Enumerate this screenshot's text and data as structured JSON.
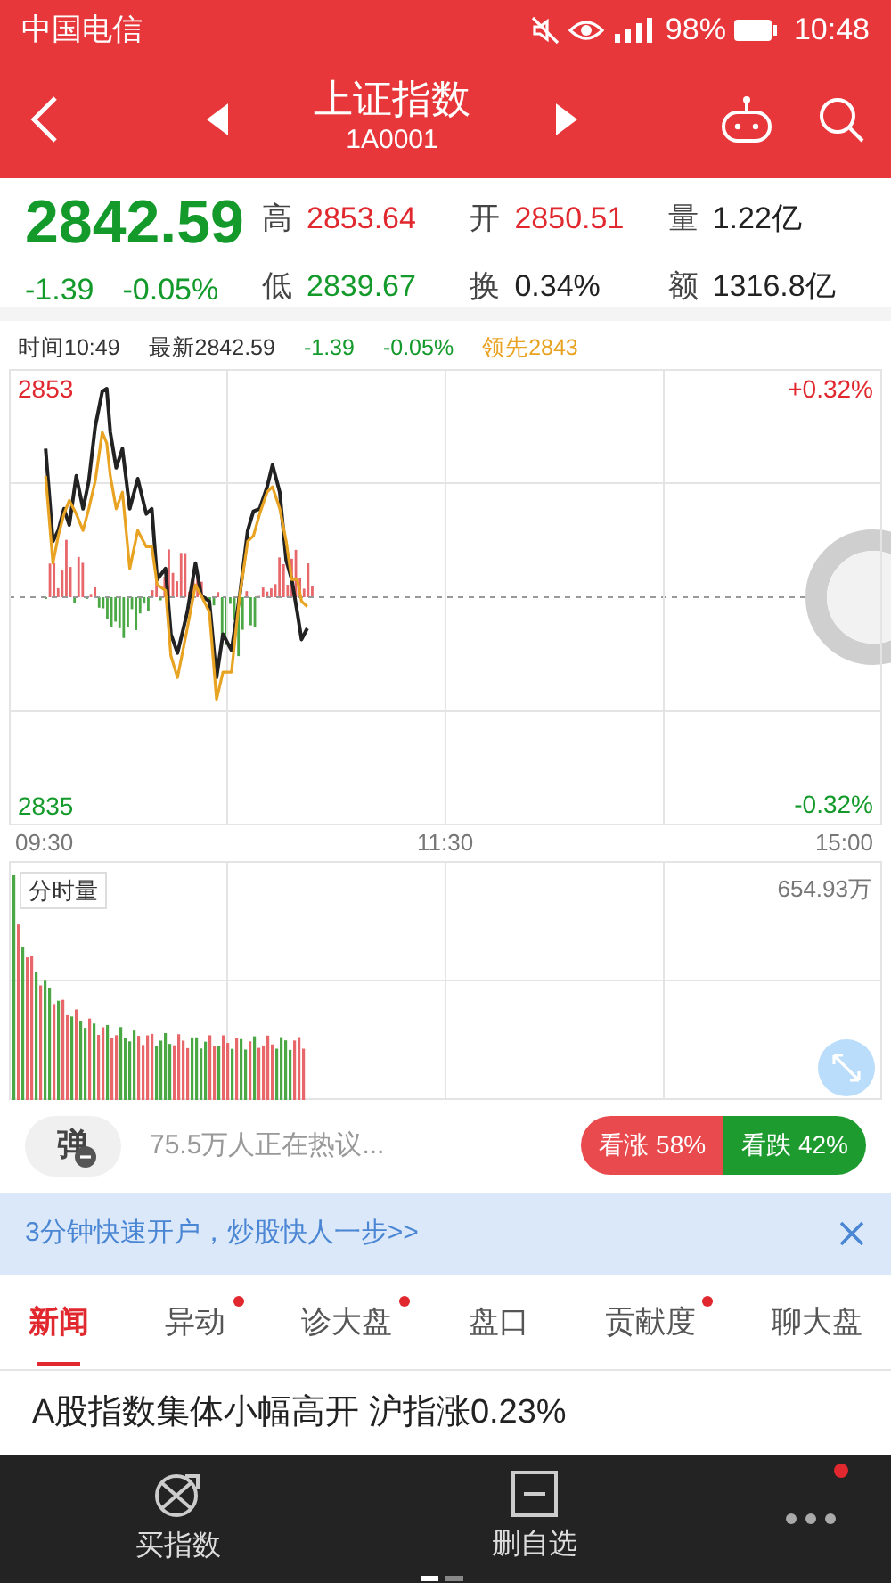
{
  "status_bar": {
    "carrier": "中国电信",
    "battery": "98%",
    "time": "10:48"
  },
  "header": {
    "title": "上证指数",
    "code": "1A0001"
  },
  "quote": {
    "price": "2842.59",
    "change": "-1.39",
    "change_pct": "-0.05%",
    "color": "#139a2b",
    "stats": [
      {
        "label": "高",
        "value": "2853.64",
        "color": "#e0282e"
      },
      {
        "label": "开",
        "value": "2850.51",
        "color": "#e0282e"
      },
      {
        "label": "量",
        "value": "1.22亿",
        "color": "#222222"
      },
      {
        "label": "低",
        "value": "2839.67",
        "color": "#139a2b"
      },
      {
        "label": "换",
        "value": "0.34%",
        "color": "#222222"
      },
      {
        "label": "额",
        "value": "1316.8亿",
        "color": "#222222"
      }
    ]
  },
  "legend": [
    {
      "text": "时间10:49",
      "color": "#333333"
    },
    {
      "text": "最新2842.59",
      "color": "#333333"
    },
    {
      "text": "-1.39",
      "color": "#139a2b"
    },
    {
      "text": "-0.05%",
      "color": "#139a2b"
    },
    {
      "text": "领先2843",
      "color": "#e8a322"
    }
  ],
  "chart": {
    "right_labels": [
      "+0.32%",
      "-0.32%"
    ],
    "close_label": "15:00",
    "chart_data": {
      "type": "line",
      "xlim": [
        9.322,
        13.678
      ],
      "ylim": [
        2834.15,
        2853.85
      ],
      "xticks": [
        {
          "value": 9.5,
          "label": "09:30"
        },
        {
          "value": 11.5,
          "label": "11:30"
        }
      ],
      "yticks": [
        {
          "value": 2853,
          "label": "2853"
        },
        {
          "value": 2835,
          "label": "2835"
        }
      ],
      "x": [
        9.505,
        9.542,
        9.568,
        9.597,
        9.623,
        9.658,
        9.692,
        9.72,
        9.752,
        9.788,
        9.81,
        9.828,
        9.857,
        9.888,
        9.925,
        9.965,
        10.007,
        10.035,
        10.062,
        10.103,
        10.13,
        10.163,
        10.212,
        10.253,
        10.282,
        10.322,
        10.358,
        10.39,
        10.432,
        10.473,
        10.513,
        10.542,
        10.573,
        10.61,
        10.637,
        10.673,
        10.705,
        10.733,
        10.76,
        10.782,
        10.81
      ],
      "series": [
        {
          "color": "#222222",
          "values": [
            2850.41,
            2846.41,
            2846.88,
            2847.82,
            2847.12,
            2849.24,
            2847.82,
            2849.0,
            2851.35,
            2852.88,
            2853.0,
            2851.12,
            2849.59,
            2850.41,
            2847.82,
            2849.12,
            2847.59,
            2847.82,
            2844.76,
            2845.24,
            2842.41,
            2841.59,
            2843.35,
            2845.47,
            2844.06,
            2843.82,
            2840.53,
            2842.41,
            2841.71,
            2844.06,
            2846.88,
            2847.71,
            2847.82,
            2848.76,
            2849.71,
            2848.53,
            2845.59,
            2844.76,
            2843.35,
            2842.18,
            2842.65
          ]
        },
        {
          "color": "#e8a322",
          "values": [
            2849.24,
            2845.47,
            2846.65,
            2847.59,
            2848.18,
            2847.59,
            2846.88,
            2847.82,
            2849.0,
            2851.12,
            2850.65,
            2849.24,
            2847.82,
            2848.53,
            2845.24,
            2846.88,
            2846.18,
            2846.18,
            2844.53,
            2844.29,
            2841.47,
            2840.53,
            2842.65,
            2844.53,
            2844.06,
            2843.35,
            2839.59,
            2840.76,
            2840.76,
            2844.06,
            2846.41,
            2846.65,
            2847.59,
            2848.53,
            2848.76,
            2847.82,
            2846.41,
            2844.76,
            2844.76,
            2843.82,
            2843.59
          ]
        }
      ]
    }
  },
  "volume": {
    "title": "分时量",
    "max": "654.93万"
  },
  "discussion": {
    "button": "弹",
    "text": "75.5万人正在热议...",
    "bull": "看涨 58%",
    "bear": "看跌 42%"
  },
  "banner": {
    "text": "3分钟快速开户，炒股快人一步>>"
  },
  "tabs": [
    {
      "label": "新闻",
      "selected": true,
      "dot": false
    },
    {
      "label": "异动",
      "selected": false,
      "dot": true
    },
    {
      "label": "诊大盘",
      "selected": false,
      "dot": true
    },
    {
      "label": "盘口",
      "selected": false,
      "dot": false
    },
    {
      "label": "贡献度",
      "selected": false,
      "dot": true
    },
    {
      "label": "聊大盘",
      "selected": false,
      "dot": false
    }
  ],
  "news": [
    {
      "title": "A股指数集体小幅高开 沪指涨0.23%"
    }
  ],
  "bottom_bar": {
    "items": [
      {
        "kind": "trade",
        "label": "买指数"
      },
      {
        "kind": "remove",
        "label": "删自选"
      },
      {
        "kind": "more",
        "badge": true
      }
    ],
    "pages": [
      {
        "selected": true
      },
      {
        "selected": false
      }
    ]
  }
}
